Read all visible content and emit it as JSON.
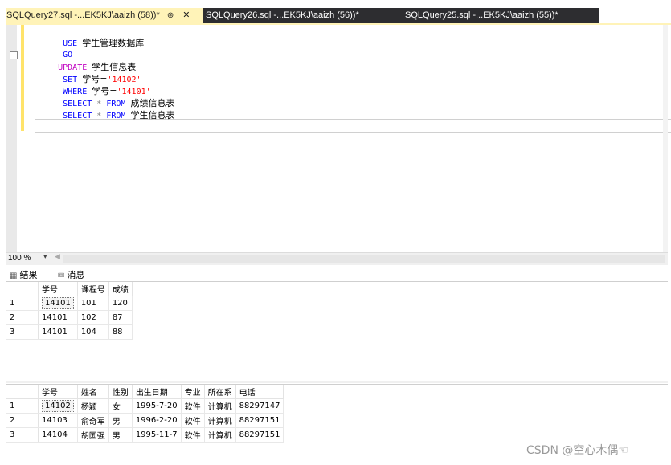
{
  "tabs": [
    {
      "label": "SQLQuery27.sql -...EK5KJ\\aaizh (58))*",
      "active": true
    },
    {
      "label": "SQLQuery26.sql -...EK5KJ\\aaizh (56))*",
      "active": false
    },
    {
      "label": "SQLQuery25.sql -...EK5KJ\\aaizh (55))*",
      "active": false
    }
  ],
  "tab_pin_icon": "pin-icon",
  "tab_close_icon": "close-icon",
  "editor": {
    "lines": [
      {
        "kw": "USE",
        "rest": "学生管理数据库"
      },
      {
        "kw": "GO",
        "rest": ""
      },
      {
        "kw": "UPDATE",
        "rest": "学生信息表"
      },
      {
        "kw": "SET",
        "col": "学号=",
        "str": "'14102'"
      },
      {
        "kw": "WHERE",
        "col": "学号=",
        "str": "'14101'"
      },
      {
        "kw": "SELECT",
        "op": "*",
        "kw2": "FROM",
        "rest": "成绩信息表"
      },
      {
        "kw": "SELECT",
        "op": "*",
        "kw2": "FROM",
        "rest": "学生信息表"
      }
    ]
  },
  "zoom": "100 %",
  "result_tabs": {
    "results": "结果",
    "messages": "消息"
  },
  "grid1": {
    "columns": [
      "学号",
      "课程号",
      "成绩"
    ],
    "rows": [
      [
        "1",
        "14101",
        "101",
        "120"
      ],
      [
        "2",
        "14101",
        "102",
        "87"
      ],
      [
        "3",
        "14101",
        "104",
        "88"
      ]
    ]
  },
  "grid2": {
    "columns": [
      "学号",
      "姓名",
      "性别",
      "出生日期",
      "专业",
      "所在系",
      "电话"
    ],
    "rows": [
      [
        "1",
        "14102",
        "杨颖",
        "女",
        "1995-7-20",
        "软件",
        "计算机",
        "88297147"
      ],
      [
        "2",
        "14103",
        "俞奇军",
        "男",
        "1996-2-20",
        "软件",
        "计算机",
        "88297151"
      ],
      [
        "3",
        "14104",
        "胡国强",
        "男",
        "1995-11-7",
        "软件",
        "计算机",
        "88297151"
      ]
    ]
  },
  "watermark": "CSDN @空心木偶☜",
  "colors": {
    "active_tab": "#fff3b8",
    "tabstrip": "#2d2d30",
    "keyword": "#0000ff",
    "string": "#ff0000",
    "update_keyword": "#c000c0"
  }
}
